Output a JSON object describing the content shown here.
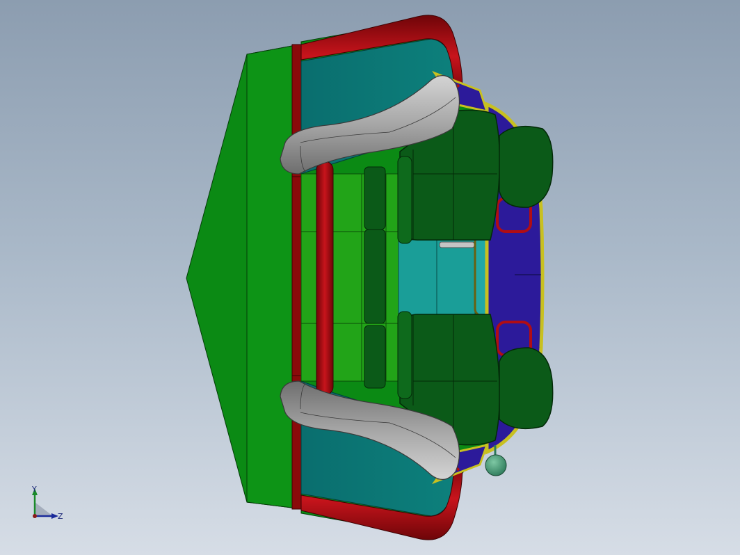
{
  "viewport": {
    "background_top": "#8c9db0",
    "background_bottom": "#d6dde6"
  },
  "model": {
    "colors": {
      "body_green": "#0a8a14",
      "frame_red": "#8a0a0a",
      "tube_red": "#b00d14",
      "glass_teal": "#0a7472",
      "light_teal": "#1a9e98",
      "seat_dark_green": "#0b5a18",
      "handle_gray": "#a0a0a0",
      "panel_blue": "#2c1a9a",
      "trim_yellow": "#c8c020",
      "floor_green": "#22a418"
    }
  },
  "triad": {
    "icon": "coordinate-triad-icon",
    "y_label": "Y",
    "z_label": "Z"
  }
}
